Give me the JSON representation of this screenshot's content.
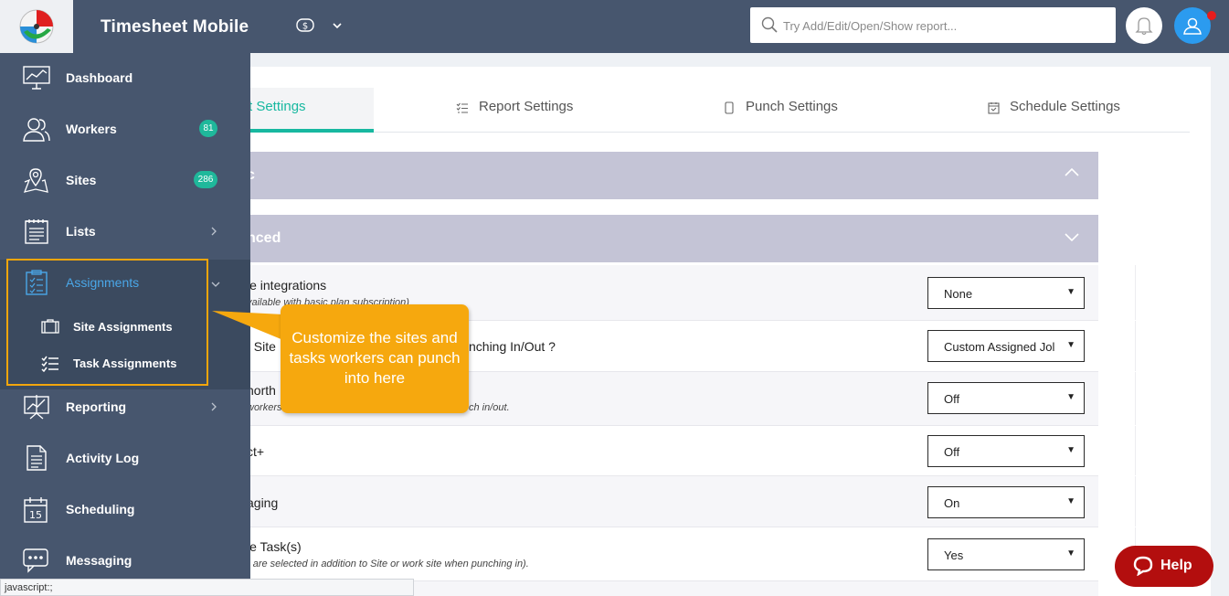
{
  "header": {
    "app_title": "Timesheet Mobile",
    "search_placeholder": "Try Add/Edit/Open/Show report...",
    "colors": {
      "header_bg": "#47566e",
      "accent": "#17b8a0",
      "user_avatar": "#2b9bef",
      "notification_dot": "#e81c1c"
    }
  },
  "sidebar": {
    "items": [
      {
        "label": "Dashboard",
        "icon": "dashboard-icon"
      },
      {
        "label": "Workers",
        "icon": "workers-icon",
        "badge": "81"
      },
      {
        "label": "Sites",
        "icon": "map-pin-icon",
        "badge": "286"
      },
      {
        "label": "Lists",
        "icon": "list-icon"
      },
      {
        "label": "Assignments",
        "icon": "clipboard-icon"
      },
      {
        "label": "Reporting",
        "icon": "chart-icon"
      },
      {
        "label": "Activity Log",
        "icon": "document-icon"
      },
      {
        "label": "Scheduling",
        "icon": "calendar-icon"
      },
      {
        "label": "Messaging",
        "icon": "chat-icon"
      }
    ],
    "calendar_day": "15",
    "sub_items": [
      {
        "label": "Site Assignments",
        "icon": "briefcase-icon"
      },
      {
        "label": "Task Assignments",
        "icon": "checklist-icon"
      }
    ]
  },
  "tabs": [
    {
      "label": "t Settings",
      "active": true
    },
    {
      "label": "Report Settings"
    },
    {
      "label": "Punch Settings"
    },
    {
      "label": "Schedule Settings"
    }
  ],
  "sections": [
    {
      "title": "c"
    },
    {
      "title": "nced"
    }
  ],
  "rows": [
    {
      "label": "le integrations",
      "sub": "vailable with basic plan subscription)",
      "value": "None"
    },
    {
      "label": "t Site",
      "label2": "nching In/Out ?",
      "value": "Custom Assigned Jol"
    },
    {
      "label": "north",
      "sub": "workers",
      "sub2": "ch in/out.",
      "value": "Off"
    },
    {
      "label": "ct+",
      "value": "Off"
    },
    {
      "label": "aging",
      "value": "On"
    },
    {
      "label": "le Task(s)",
      "sub": ") are selected in addition to Site or work site when punching in).",
      "value": "Yes"
    }
  ],
  "tooltip": {
    "text": "Customize the sites and tasks workers can punch into here"
  },
  "help": {
    "label": "Help",
    "color": "#b30e0e"
  },
  "statusbar": {
    "text": "javascript:;"
  }
}
